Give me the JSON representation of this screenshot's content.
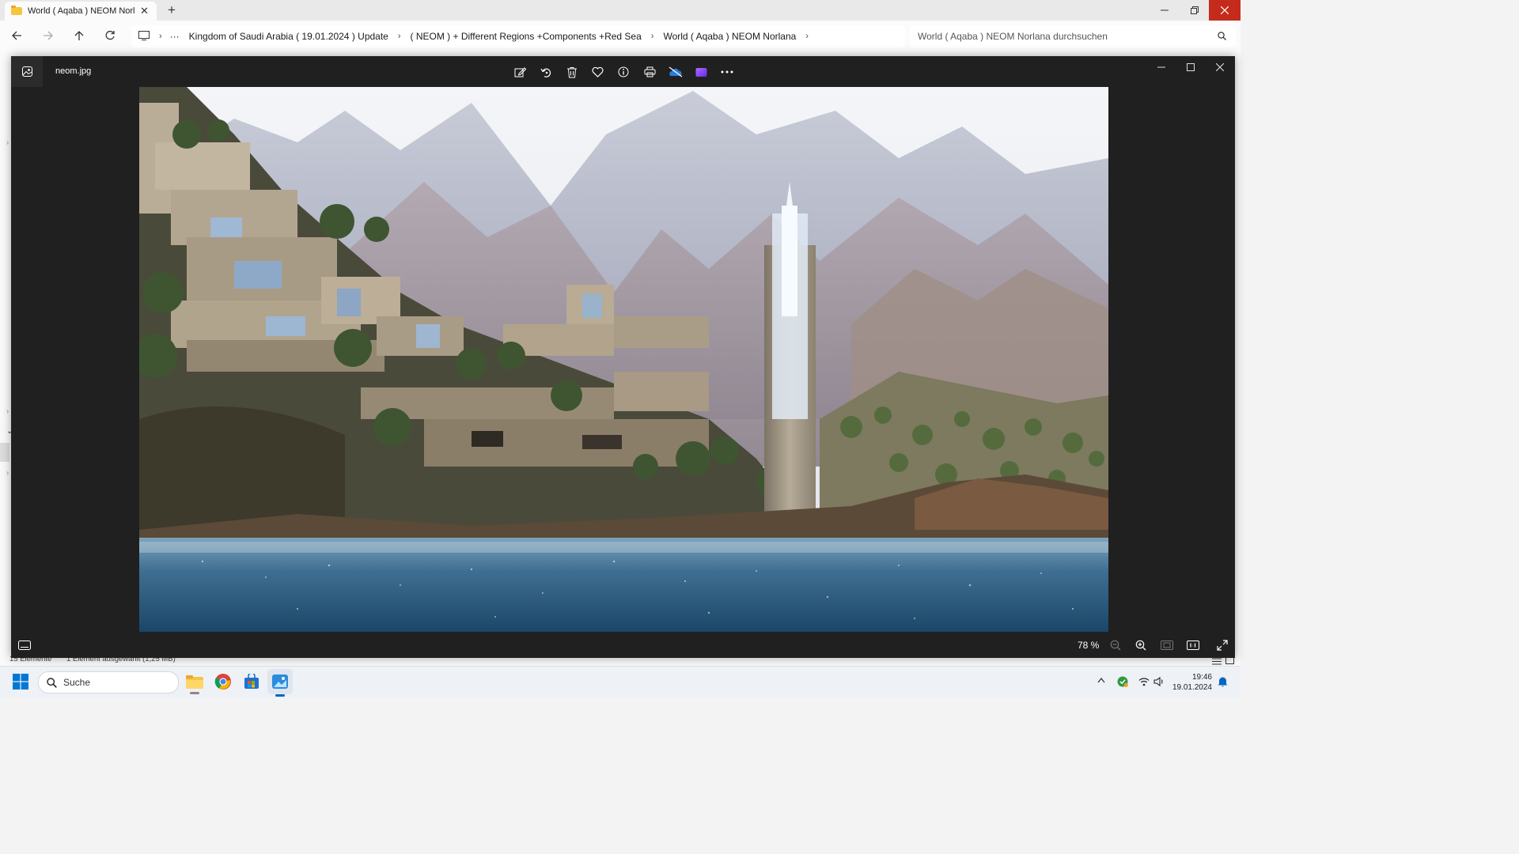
{
  "explorer": {
    "tab_title": "World ( Aqaba ) NEOM Norlana",
    "breadcrumb": [
      "Kingdom of Saudi Arabia ( 19.01.2024 ) Update",
      "( NEOM ) + Different Regions +Components +Red Sea",
      "World ( Aqaba ) NEOM Norlana"
    ],
    "search_placeholder": "World ( Aqaba ) NEOM Norlana durchsuchen",
    "status_items": "15 Elemente",
    "status_selected": "1 Element ausgewählt (1,25 MB)",
    "ellipsis": "···"
  },
  "viewer": {
    "file_name": "neom.jpg",
    "zoom_label": "78 %"
  },
  "taskbar": {
    "search_label": "Suche",
    "time": "19:46",
    "date": "19.01.2024"
  },
  "colors": {
    "close_red": "#c42b1c",
    "viewer_bg": "#202020",
    "folder_yellow": "#f5c542",
    "accent_blue": "#0067c0"
  }
}
